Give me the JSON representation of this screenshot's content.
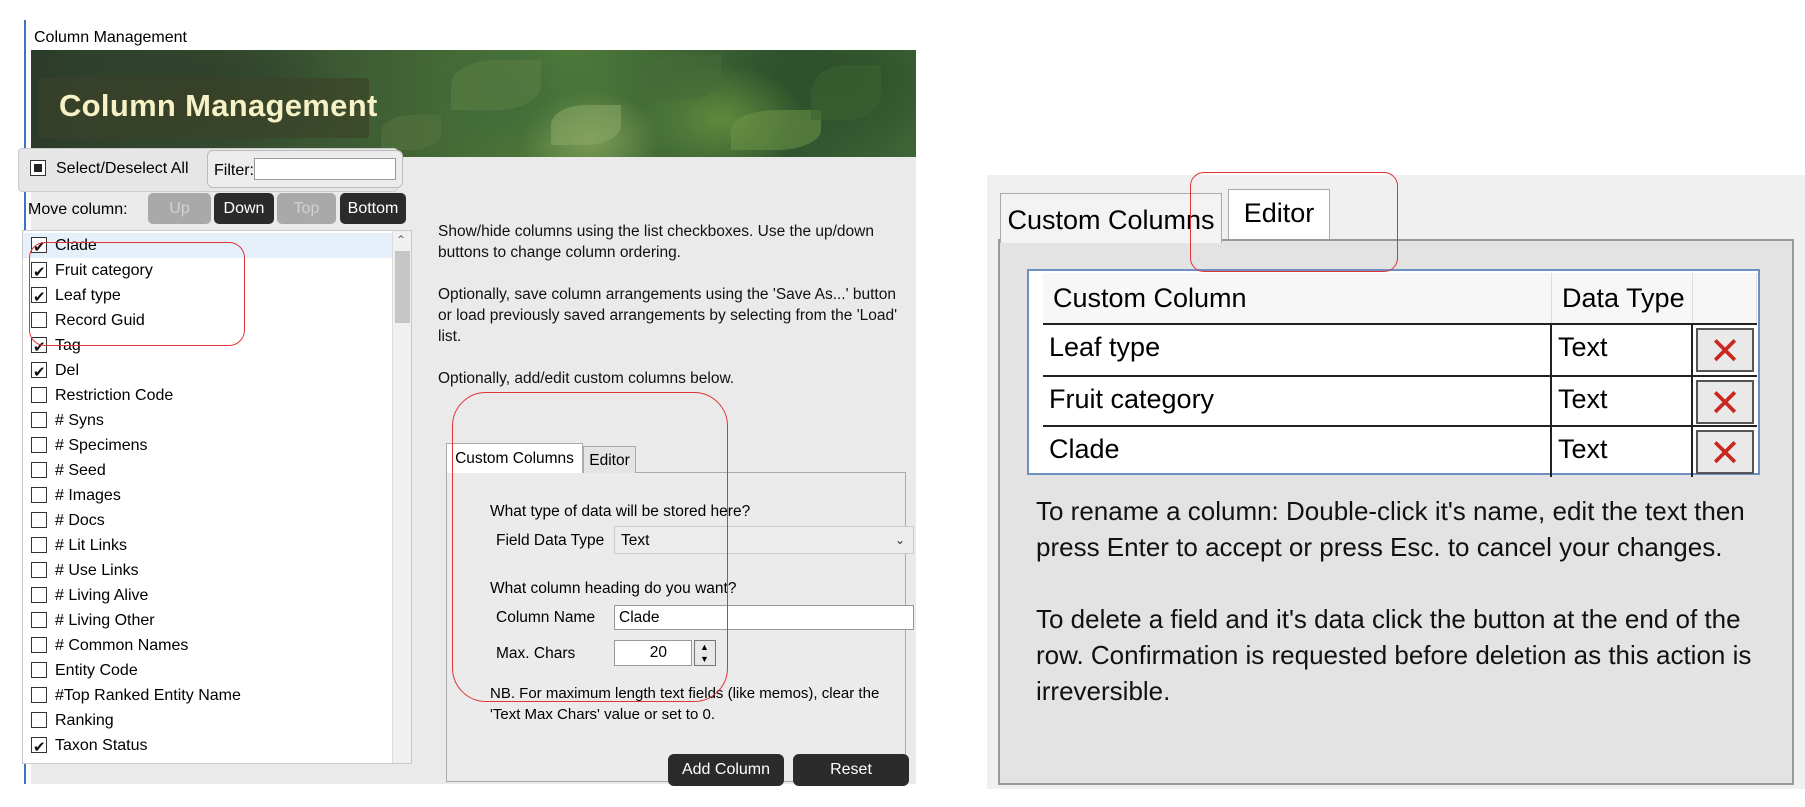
{
  "window": {
    "title": "Column Management"
  },
  "banner": {
    "title": "Column Management"
  },
  "toolbar": {
    "select_all_label": "Select/Deselect All",
    "filter_label": "Filter:",
    "filter_value": "",
    "move_label": "Move column:",
    "up": "Up",
    "down": "Down",
    "top": "Top",
    "bottom": "Bottom"
  },
  "columns": [
    {
      "label": "Clade",
      "checked": true
    },
    {
      "label": "Fruit category",
      "checked": true
    },
    {
      "label": "Leaf type",
      "checked": true
    },
    {
      "label": "Record Guid",
      "checked": false
    },
    {
      "label": "Tag",
      "checked": true
    },
    {
      "label": "Del",
      "checked": true
    },
    {
      "label": "Restriction Code",
      "checked": false
    },
    {
      "label": "# Syns",
      "checked": false
    },
    {
      "label": "# Specimens",
      "checked": false
    },
    {
      "label": "# Seed",
      "checked": false
    },
    {
      "label": "# Images",
      "checked": false
    },
    {
      "label": "# Docs",
      "checked": false
    },
    {
      "label": "# Lit Links",
      "checked": false
    },
    {
      "label": "# Use Links",
      "checked": false
    },
    {
      "label": "# Living Alive",
      "checked": false
    },
    {
      "label": "# Living Other",
      "checked": false
    },
    {
      "label": "# Common Names",
      "checked": false
    },
    {
      "label": "Entity Code",
      "checked": false
    },
    {
      "label": "#Top Ranked Entity Name",
      "checked": false
    },
    {
      "label": "Ranking",
      "checked": false
    },
    {
      "label": "Taxon Status",
      "checked": true
    }
  ],
  "help": {
    "p1": "Show/hide columns using the list checkboxes. Use the up/down buttons to change column ordering.",
    "p2": "Optionally, save column arrangements using the 'Save As...' button or load previously saved arrangements by selecting from the 'Load' list.",
    "p3": "Optionally, add/edit custom columns below."
  },
  "tabs": {
    "custom": "Custom Columns",
    "editor": "Editor"
  },
  "custom_form": {
    "q1": "What type of data will be stored here?",
    "field_data_type_label": "Field Data Type",
    "field_data_type_value": "Text",
    "q2": "What column heading do you want?",
    "column_name_label": "Column Name",
    "column_name_value": "Clade",
    "max_chars_label": "Max. Chars",
    "max_chars_value": "20",
    "nb": "NB. For maximum length text fields (like memos), clear the 'Text Max Chars' value or set to 0.",
    "add_column": "Add Column",
    "reset": "Reset"
  },
  "editor_panel": {
    "tab_custom": "Custom Columns",
    "tab_editor": "Editor",
    "headers": {
      "custom_column": "Custom Column",
      "data_type": "Data Type"
    },
    "rows": [
      {
        "name": "Leaf type",
        "type": "Text",
        "delete_icon": "close-x-icon"
      },
      {
        "name": "Fruit category",
        "type": "Text",
        "delete_icon": "close-x-icon"
      },
      {
        "name": "Clade",
        "type": "Text",
        "delete_icon": "close-x-icon"
      }
    ],
    "help1": "To rename a column: Double-click it's name, edit the text then press Enter to accept or press Esc. to cancel your changes.",
    "help2": "To delete a field and it's data click the button at the end of the row. Confirmation is requested before deletion as this action is irreversible."
  },
  "colors": {
    "annotation": "#e03438",
    "banner_text": "#f6f2c6",
    "delete_x": "#c8281f",
    "dark_button": "#2b2b2b"
  }
}
